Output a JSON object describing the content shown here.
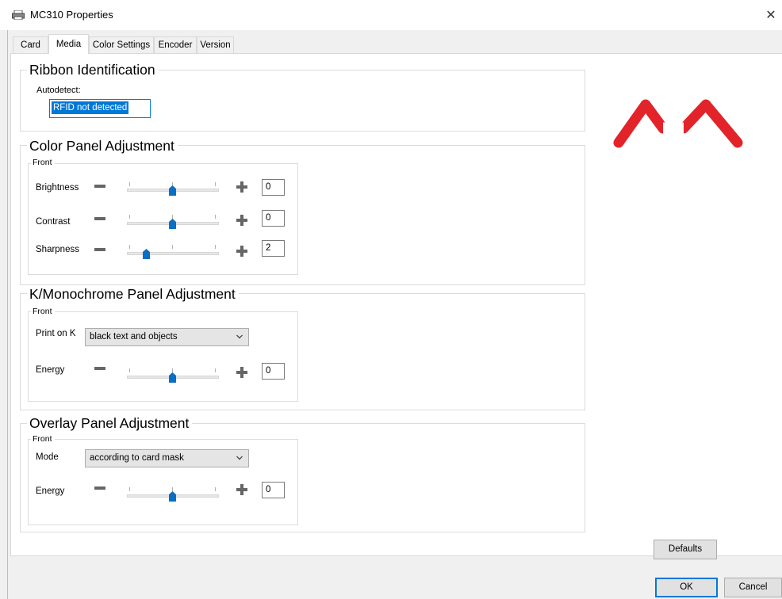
{
  "window": {
    "title": "MC310 Properties",
    "icon": "printer-icon",
    "close_icon": "close-icon"
  },
  "tabs": [
    {
      "label": "Card",
      "active": false
    },
    {
      "label": "Media",
      "active": true
    },
    {
      "label": "Color Settings",
      "active": false
    },
    {
      "label": "Encoder",
      "active": false
    },
    {
      "label": "Version",
      "active": false
    }
  ],
  "ribbon": {
    "title": "Ribbon Identification",
    "autodetect_label": "Autodetect:",
    "autodetect_value": "RFID not detected"
  },
  "color_panel": {
    "title": "Color Panel Adjustment",
    "front_label": "Front",
    "brightness": {
      "label": "Brightness",
      "value": "0",
      "level": 0.5
    },
    "contrast": {
      "label": "Contrast",
      "value": "0",
      "level": 0.5
    },
    "sharpness": {
      "label": "Sharpness",
      "value": "2",
      "level": 0.2
    }
  },
  "mono_panel": {
    "title": "K/Monochrome Panel Adjustment",
    "front_label": "Front",
    "print_on_k_label": "Print on K",
    "print_on_k_value": "black text and objects",
    "energy": {
      "label": "Energy",
      "value": "0",
      "level": 0.5
    }
  },
  "overlay_panel": {
    "title": "Overlay Panel Adjustment",
    "front_label": "Front",
    "mode_label": "Mode",
    "mode_value": "according to card mask",
    "energy": {
      "label": "Energy",
      "value": "0",
      "level": 0.5
    }
  },
  "logo": {
    "icon": "brand-logo-icon",
    "color": "#e3232a"
  },
  "buttons": {
    "defaults": "Defaults",
    "ok": "OK",
    "cancel": "Cancel"
  },
  "colors": {
    "accent": "#0078d7",
    "dialog_bg": "#f0f0f0",
    "thumb": "#0a6fc2"
  }
}
